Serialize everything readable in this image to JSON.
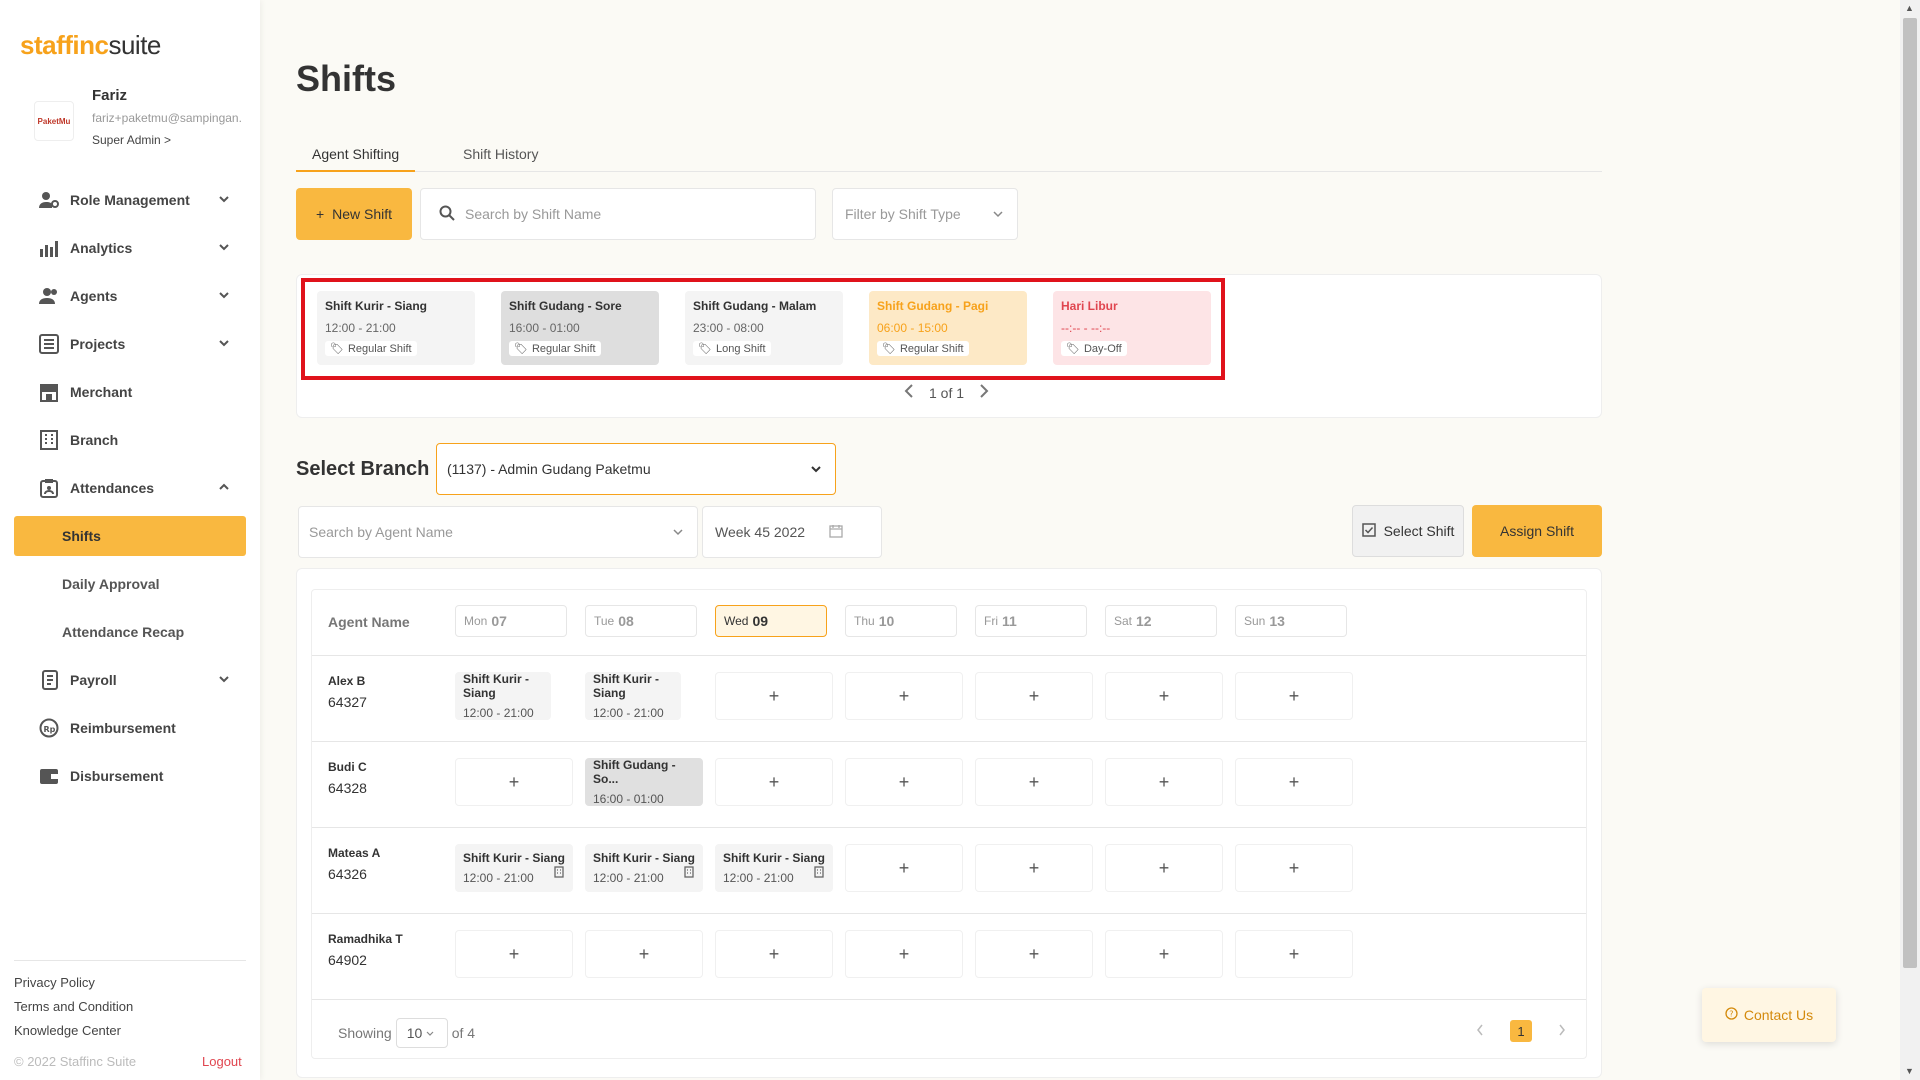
{
  "brand": {
    "logo_left": "staffinc",
    "logo_right": "suite",
    "accent": "#f7a21b"
  },
  "profile": {
    "name": "Fariz",
    "email": "fariz+paketmu@sampingan.",
    "role": "Super Admin >",
    "avatar_text": "PaketMu"
  },
  "nav": {
    "role_management": "Role Management",
    "analytics": "Analytics",
    "agents": "Agents",
    "projects": "Projects",
    "merchant": "Merchant",
    "branch": "Branch",
    "attendances": "Attendances",
    "shifts": "Shifts",
    "daily_approval": "Daily Approval",
    "attendance_recap": "Attendance Recap",
    "payroll": "Payroll",
    "reimbursement": "Reimbursement",
    "disbursement": "Disbursement"
  },
  "footer": {
    "privacy": "Privacy Policy",
    "terms": "Terms and Condition",
    "knowledge": "Knowledge Center",
    "copyright": "© 2022 Staffinc Suite",
    "logout": "Logout"
  },
  "page": {
    "title": "Shifts"
  },
  "tabs": {
    "agent_shifting": "Agent Shifting",
    "shift_history": "Shift History"
  },
  "toolbar": {
    "new_shift": "New Shift",
    "search_placeholder": "Search by Shift Name",
    "filter_placeholder": "Filter by Shift Type"
  },
  "shift_types": [
    {
      "name": "Shift Kurir - Siang",
      "time": "12:00 - 21:00",
      "tag": "Regular Shift"
    },
    {
      "name": "Shift Gudang - Sore",
      "time": "16:00 - 01:00",
      "tag": "Regular Shift"
    },
    {
      "name": "Shift Gudang - Malam",
      "time": "23:00 - 08:00",
      "tag": "Long Shift"
    },
    {
      "name": "Shift Gudang - Pagi",
      "time": "06:00 - 15:00",
      "tag": "Regular Shift"
    },
    {
      "name": "Hari Libur",
      "time": "--:-- - --:--",
      "tag": "Day-Off"
    }
  ],
  "shift_pager": {
    "label": "1 of 1"
  },
  "branch": {
    "label": "Select Branch",
    "value": "(1137) - Admin Gudang Paketmu"
  },
  "filters": {
    "agent_search_placeholder": "Search by Agent Name",
    "week": "Week 45 2022"
  },
  "actions": {
    "select_shift": "Select Shift",
    "assign_shift": "Assign Shift"
  },
  "table": {
    "agent_header": "Agent Name",
    "days": [
      {
        "d": "Mon",
        "n": "07"
      },
      {
        "d": "Tue",
        "n": "08"
      },
      {
        "d": "Wed",
        "n": "09"
      },
      {
        "d": "Thu",
        "n": "10"
      },
      {
        "d": "Fri",
        "n": "11"
      },
      {
        "d": "Sat",
        "n": "12"
      },
      {
        "d": "Sun",
        "n": "13"
      }
    ],
    "rows": [
      {
        "name": "Alex B",
        "id": "64327"
      },
      {
        "name": "Budi C",
        "id": "64328"
      },
      {
        "name": "Mateas A",
        "id": "64326"
      },
      {
        "name": "Ramadhika T",
        "id": "64902"
      }
    ],
    "cells": {
      "alex_mon": {
        "name": "Shift Kurir - Siang",
        "time": "12:00 - 21:00"
      },
      "alex_tue": {
        "name": "Shift Kurir - Siang",
        "time": "12:00 - 21:00"
      },
      "budi_tue": {
        "name": "Shift Gudang - So...",
        "time": "16:00 - 01:00"
      },
      "mateas_mon": {
        "name": "Shift Kurir - Siang",
        "time": "12:00 - 21:00"
      },
      "mateas_tue": {
        "name": "Shift Kurir - Siang",
        "time": "12:00 - 21:00"
      },
      "mateas_wed": {
        "name": "Shift Kurir - Siang",
        "time": "12:00 - 21:00"
      }
    },
    "add_symbol": "+"
  },
  "table_footer": {
    "showing": "Showing",
    "page_size": "10",
    "of_total": "of 4",
    "current_page": "1"
  },
  "contact": {
    "label": "Contact Us"
  }
}
